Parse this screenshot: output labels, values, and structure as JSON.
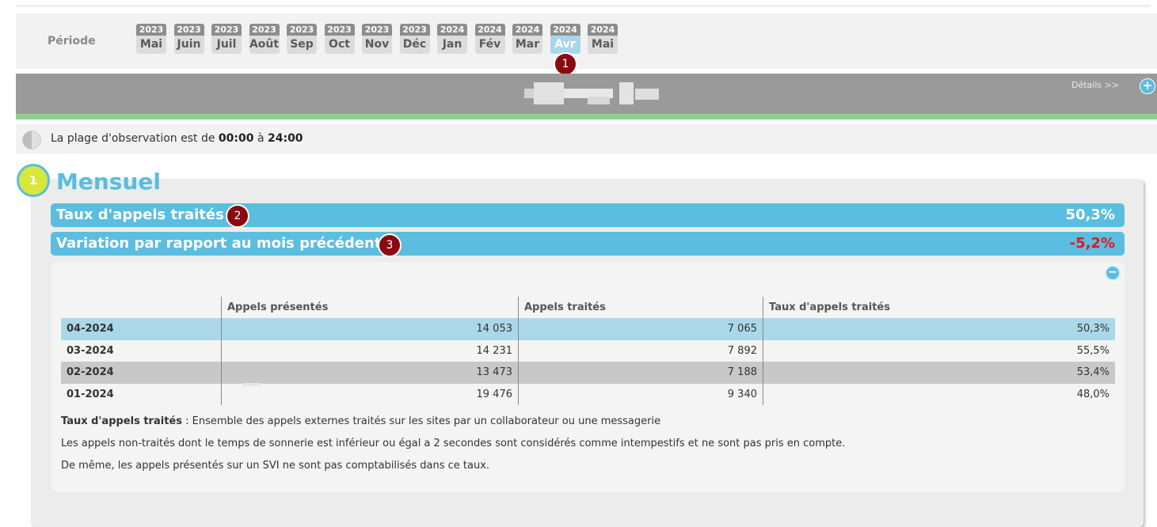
{
  "period": {
    "label": "Période",
    "months": [
      {
        "year": "2023",
        "month": "Mai",
        "active": false
      },
      {
        "year": "2023",
        "month": "Juin",
        "active": false
      },
      {
        "year": "2023",
        "month": "Juil",
        "active": false
      },
      {
        "year": "2023",
        "month": "Août",
        "active": false
      },
      {
        "year": "2023",
        "month": "Sep",
        "active": false
      },
      {
        "year": "2023",
        "month": "Oct",
        "active": false
      },
      {
        "year": "2023",
        "month": "Nov",
        "active": false
      },
      {
        "year": "2023",
        "month": "Déc",
        "active": false
      },
      {
        "year": "2024",
        "month": "Jan",
        "active": false
      },
      {
        "year": "2024",
        "month": "Fév",
        "active": false
      },
      {
        "year": "2024",
        "month": "Mar",
        "active": false
      },
      {
        "year": "2024",
        "month": "Avr",
        "active": true
      },
      {
        "year": "2024",
        "month": "Mai",
        "active": false
      }
    ]
  },
  "badges": {
    "b1": "1",
    "b2": "2",
    "b3": "3"
  },
  "header": {
    "details_link": "Détails >>",
    "plus_icon": "+"
  },
  "observation": {
    "prefix": "La plage d'observation est de ",
    "start": "00:00",
    "middle": " à ",
    "end": "24:00"
  },
  "section": {
    "number": "1",
    "title": "Mensuel"
  },
  "kpis": [
    {
      "label": "Taux d'appels traités",
      "value": "50,3%"
    },
    {
      "label": "Variation par rapport au mois précédent",
      "value": "-5,2%"
    }
  ],
  "table": {
    "headers": [
      "",
      "Appels présentés",
      "Appels traités",
      "Taux d'appels traités"
    ],
    "rows": [
      [
        "04-2024",
        "14 053",
        "7 065",
        "50,3%"
      ],
      [
        "03-2024",
        "14 231",
        "7 892",
        "55,5%"
      ],
      [
        "02-2024",
        "13 473",
        "7 188",
        "53,4%"
      ],
      [
        "01-2024",
        "19 476",
        "9 340",
        "48,0%"
      ]
    ]
  },
  "notes": {
    "n1_bold": "Taux d'appels traités",
    "n1_text": " : Ensemble des appels externes traités sur les sites par un collaborateur ou une messagerie",
    "n2": "Les appels non-traités dont le temps de sonnerie est inférieur ou égal a 2 secondes sont considérés comme intempestifs et ne sont pas pris en compte.",
    "n3": "De même, les appels présentés sur un SVI ne sont pas comptabilisés dans ce taux."
  },
  "colors": {
    "accent": "#5bbde0",
    "negative": "#e0181b",
    "badge": "#8b0a10",
    "green": "#8dd18a"
  }
}
